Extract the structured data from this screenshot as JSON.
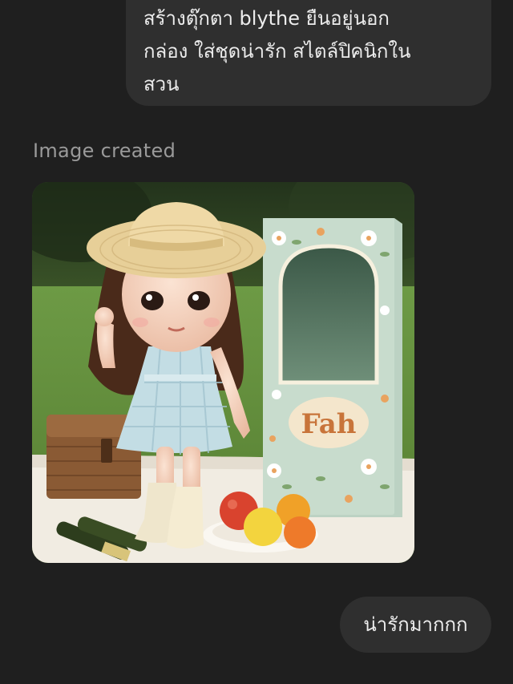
{
  "messages": {
    "user_prompt_lines": [
      "สร้างตุ๊กตา blythe ยืนอยู่นอก",
      "กล่อง ใส่ชุดน่ารัก สไตล์ปิคนิกใน",
      "สวน"
    ],
    "image_caption": "Image created",
    "image_box_label": "Fah",
    "user_reply": "น่ารักมากกก"
  },
  "colors": {
    "background": "#1f1f1f",
    "bubble": "#2f2f2f",
    "text": "#ececec",
    "caption": "#9a9a9a"
  }
}
